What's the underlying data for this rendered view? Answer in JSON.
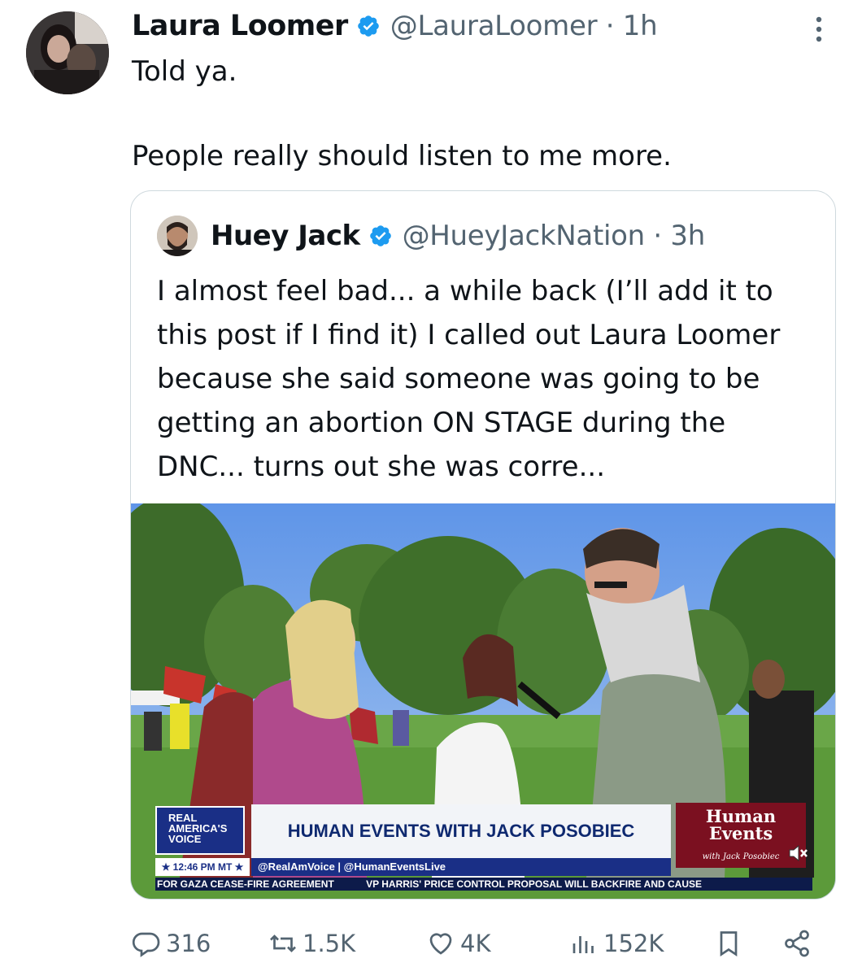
{
  "post": {
    "author_name": "Laura Loomer",
    "handle_time": "@LauraLoomer · 1h",
    "text_line1": "Told ya.",
    "text_line2": "People really should listen to me more."
  },
  "quote": {
    "author_name": "Huey Jack",
    "handle_time": "@HueyJackNation · 3h",
    "text": "I almost feel bad... a while back (I’ll add it to this post if I find it) I called out Laura Loomer because she said someone was going to be getting an abortion ON STAGE during the DNC... turns out she was corre...",
    "media": {
      "network_logo": "REAL AMERICA'S VOICE",
      "show_title": "HUMAN EVENTS WITH JACK POSOBIEC",
      "show_logo_line1": "Human",
      "show_logo_line2": "Events",
      "show_logo_sub": "with Jack Posobiec",
      "time": "★ 12:46 PM MT ★",
      "social": "@RealAmVoice | @HumanEventsLive",
      "ticker_1": "FOR GAZA CEASE-FIRE AGREEMENT",
      "ticker_2": "VP HARRIS' PRICE CONTROL PROPOSAL WILL BACKFIRE AND CAUSE"
    }
  },
  "actions": {
    "replies": "316",
    "reposts": "1.5K",
    "likes": "4K",
    "views": "152K"
  },
  "colors": {
    "verified": "#1d9bf0",
    "secondary_text": "#536471",
    "border": "#cfd9de"
  }
}
